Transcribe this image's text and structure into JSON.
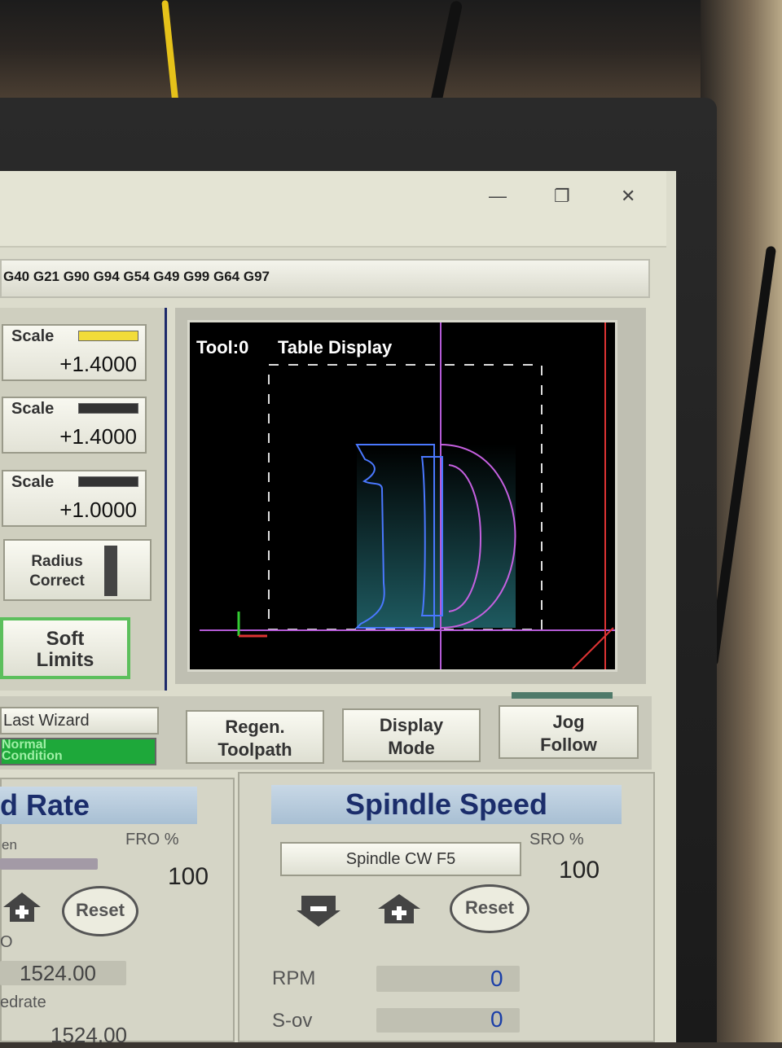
{
  "window": {
    "minimize_icon": "—",
    "maximize_icon": "❐",
    "close_icon": "✕"
  },
  "gcode_line": "G40 G21 G90 G94 G54 G49 G99 G64 G97",
  "scales": [
    {
      "label": "Scale",
      "value": "+1.4000",
      "indicator_color": "#f2dc3a"
    },
    {
      "label": "Scale",
      "value": "+1.4000",
      "indicator_color": "#333333"
    },
    {
      "label": "Scale",
      "value": "+1.0000",
      "indicator_color": "#333333"
    }
  ],
  "radius_correct": {
    "line1": "Radius",
    "line2": "Correct"
  },
  "soft_limits": {
    "line1": "Soft",
    "line2": "Limits"
  },
  "last_wizard": "Last Wizard",
  "status": {
    "line1": "Normal",
    "line2": "Condition",
    "color": "#1ea83a"
  },
  "display": {
    "tool": "Tool:0",
    "mode": "Table Display"
  },
  "toolbar": {
    "regen": {
      "line1": "Regen.",
      "line2": "Toolpath"
    },
    "display_mode": {
      "line1": "Display",
      "line2": "Mode"
    },
    "jog_follow": {
      "line1": "Jog",
      "line2": "Follow"
    }
  },
  "feed": {
    "title": "d Rate",
    "partial_label": "en",
    "fro_label": "FRO %",
    "fro_value": "100",
    "reset": "Reset",
    "label_o": "O",
    "value1": "1524.00",
    "feedrate_label": "edrate",
    "value2": "1524.00"
  },
  "spindle": {
    "title": "Spindle Speed",
    "direction": "Spindle CW F5",
    "sro_label": "SRO %",
    "sro_value": "100",
    "reset": "Reset",
    "rpm_label": "RPM",
    "rpm_value": "0",
    "sov_label": "S-ov",
    "sov_value": "0"
  }
}
